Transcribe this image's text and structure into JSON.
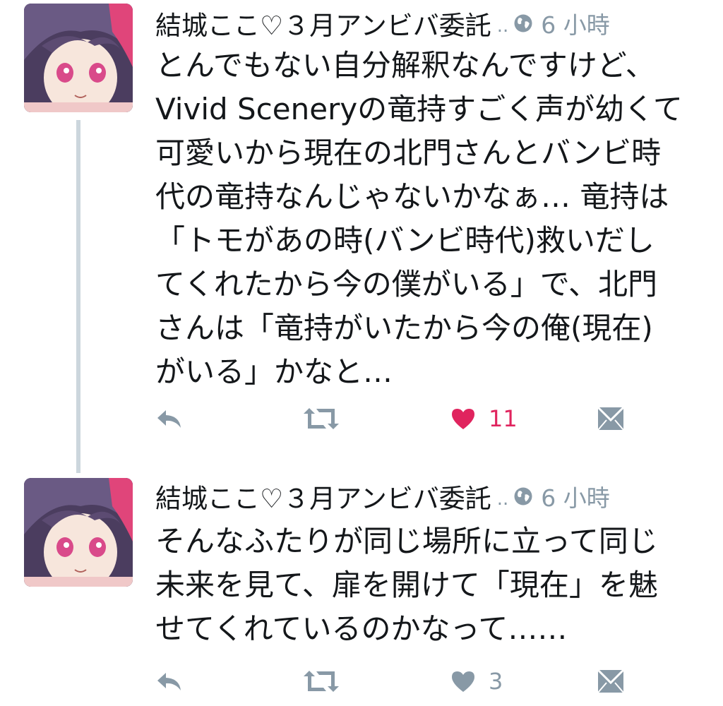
{
  "tweets": [
    {
      "author": "結城ここ♡３月アンビバ委託",
      "truncation": "..",
      "time": "6 小時",
      "text": "とんでもない自分解釈なんですけど、\nVivid Sceneryの竜持すごく声が幼くて\n可愛いから現在の北門さんとバンビ時\n代の竜持なんじゃないかなぁ… 竜持は\n「トモがあの時(バンビ時代)救いだし\nてくれたから今の僕がいる」で、北門\nさんは「竜持がいたから今の俺(現在)\nがいる」かなと…",
      "like_count": "11",
      "liked": true
    },
    {
      "author": "結城ここ♡３月アンビバ委託",
      "truncation": "..",
      "time": "6 小時",
      "text": "そんなふたりが同じ場所に立って同じ\n未来を見て、扉を開けて「現在」を魅\nせてくれているのかなって……",
      "like_count": "3",
      "liked": false
    }
  ],
  "colors": {
    "like_active": "#e0245e",
    "icon_gray": "#8899a6",
    "thread_line": "#ccd6dd"
  },
  "icons": [
    "reply-icon",
    "retweet-icon",
    "heart-icon",
    "direct-message-icon",
    "globe-icon"
  ]
}
